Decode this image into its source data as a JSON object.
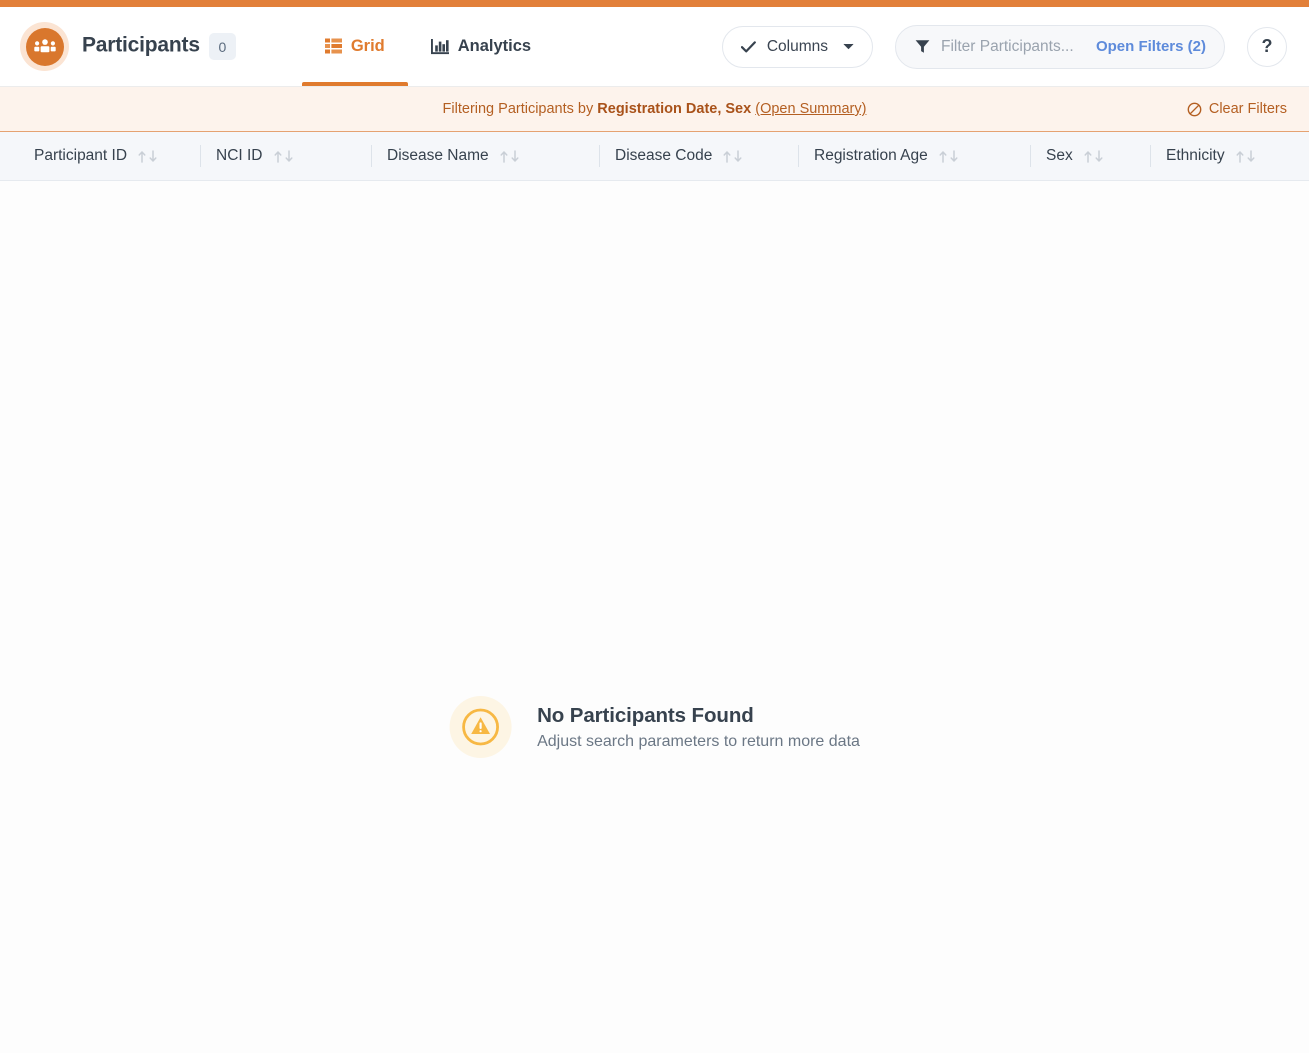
{
  "header": {
    "avatar_icon": "participants-group-icon",
    "title": "Participants",
    "count": "0",
    "tabs": [
      {
        "label": "Grid",
        "icon": "grid-icon",
        "active": true
      },
      {
        "label": "Analytics",
        "icon": "bar-chart-icon",
        "active": false
      }
    ],
    "columns_button": {
      "label": "Columns",
      "check_icon": "check-icon",
      "caret_icon": "chevron-down-icon"
    },
    "filter": {
      "icon": "funnel-filter-icon",
      "value": "",
      "placeholder": "Filter Participants...",
      "open_filters_label": "Open Filters (2)"
    },
    "help_button": {
      "label": "?",
      "icon": "question-mark-icon"
    }
  },
  "filter_banner": {
    "prefix": "Filtering Participants by ",
    "fields": "Registration Date, Sex",
    "summary_link": "(Open Summary)",
    "clear_label": "Clear Filters",
    "clear_icon": "no-entry-icon"
  },
  "table": {
    "columns": [
      {
        "label": "Participant ID",
        "sortable": true
      },
      {
        "label": "NCI ID",
        "sortable": true
      },
      {
        "label": "Disease Name",
        "sortable": true
      },
      {
        "label": "Disease Code",
        "sortable": true
      },
      {
        "label": "Registration Age",
        "sortable": true
      },
      {
        "label": "Sex",
        "sortable": true
      },
      {
        "label": "Ethnicity",
        "sortable": true
      }
    ],
    "rows": [],
    "empty_state": {
      "icon": "warning-triangle-icon",
      "title": "No Participants Found",
      "subtitle": "Adjust search parameters to return more data"
    }
  },
  "colors": {
    "brand_orange": "#E2803A",
    "accent_orange": "#E07B2E",
    "avatar_orange": "#D9772D",
    "banner_bg": "#FDF3EC",
    "banner_text": "#B45F22",
    "link_blue": "#5E8BDB",
    "header_row_bg": "#F5F7FA",
    "warning_yellow": "#F7B844",
    "text_dark": "#37424E",
    "text_muted": "#6B7785"
  }
}
